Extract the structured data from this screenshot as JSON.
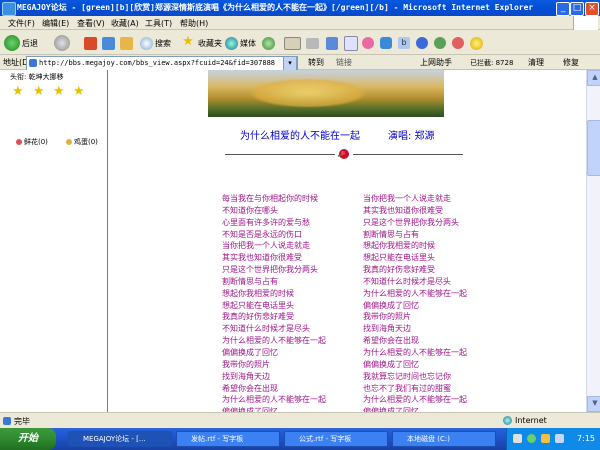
{
  "window": {
    "title": "MEGAJOY论坛 - [green][b][欣赏]郑源深情斯底演唱《为什么相爱的人不能在一起》[/green][/b] - Microsoft Internet Explorer",
    "min": "_",
    "max": "□",
    "close": "×"
  },
  "menu": [
    "文件(F)",
    "编辑(E)",
    "查看(V)",
    "收藏(A)",
    "工具(T)",
    "帮助(H)"
  ],
  "toolbar": {
    "back": "后退",
    "search": "搜索",
    "favorites": "收藏夹",
    "media": "媒体"
  },
  "address": {
    "label": "地址(D)",
    "url": "http://bbs.megajoy.com/bbs_view.aspx?fcuid=24&fid=307888",
    "go": "转到",
    "links": "链接",
    "prev_page": "上网助手",
    "blocked": "已拦截: 8728",
    "clean": "清理",
    "repair": "修复"
  },
  "left_panel": {
    "header": "头衔: 乾坤大挪移",
    "flower_label": "鲜花",
    "flower_count": "(0)",
    "egg_label": "鸡蛋",
    "egg_count": "(0)"
  },
  "post": {
    "title": "为什么相爱的人不能在一起",
    "singer": "演唱: 郑源",
    "lyrics_left": [
      "每当我在与你相起你的时候",
      "不知道你在哪头",
      "心里面有许多许的爱与愁",
      "不知是否是永远的伤口",
      "当你把我一个人说走就走",
      "其实我也知道你很难受",
      "只是这个世界把你我分两头",
      "割断情思与占有",
      "想起你我相爱的时候",
      "想起只能在电话里头",
      "我真的好伤悲好难受",
      "不知道什么时候才是尽头",
      "为什么相爱的人不能够在一起",
      "偏偏换成了回忆",
      "我带你的照片",
      "找到海角天边",
      "希望你会在出现",
      "为什么相爱的人不能够在一起",
      "偏偏换成了回忆"
    ],
    "lyrics_right": [
      "当你把我一个人说走就走",
      "其实我也知道你很难受",
      "只是这个世界把你我分两头",
      "割断情思与占有",
      "想起你我相爱的时候",
      "想起只能在电话里头",
      "我真的好伤悲好难受",
      "不知道什么时候才是尽头",
      "为什么相爱的人不能够在一起",
      "偏偏换成了回忆",
      "我带你的照片",
      "找到海角天边",
      "希望你会在出现",
      "为什么相爱的人不能够在一起",
      "偏偏换成了回忆",
      "我就算忘记时间也忘记你",
      "也忘不了我们有过的甜蜜",
      "为什么相爱的人不能够在一起",
      "偏偏换成了回忆"
    ]
  },
  "status": {
    "text": "完毕",
    "zone": "Internet"
  },
  "taskbar": {
    "start": "开始",
    "tasks": [
      "MEGAJOY论坛 - [...",
      "发帖.rtf - 写字板",
      "公式.rtf - 写字板",
      "本地磁盘 (C:)"
    ],
    "clock": "7:15"
  },
  "colors": {
    "lyrics": "#a0158a",
    "title_blue": "#0000cc"
  }
}
